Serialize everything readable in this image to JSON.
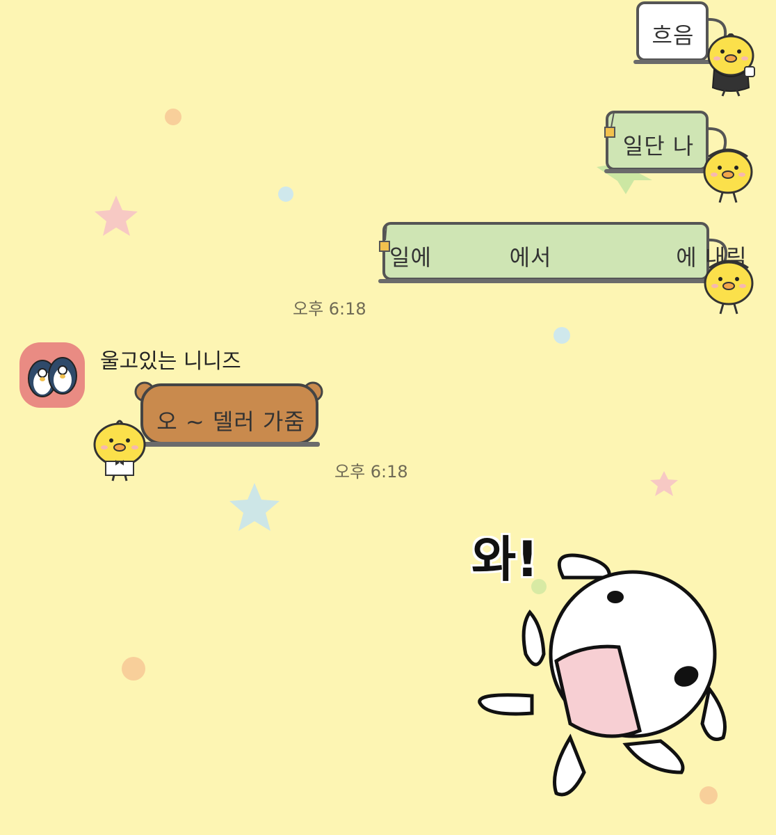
{
  "theme": {
    "background": "#fdf5b3",
    "sent_bubble": "#cfe5b4",
    "sent_plain_bubble": "#ffffff",
    "received_bubble": "#c98a4d"
  },
  "sent": {
    "msg1": {
      "text": "흐음",
      "icon": "butler-chick-icon"
    },
    "msg2": {
      "text": "일단 나",
      "icon": "maid-chick-icon"
    },
    "msg3": {
      "text": "일에          에서                에 내림",
      "icon": "maid-chick-icon"
    },
    "time": "오후 6:18"
  },
  "received": {
    "sender_name": "울고있는 니니즈",
    "avatar": "penguin-pair-avatar",
    "msg1": {
      "text": "오 ~ 델러 가줌",
      "icon": "waiter-chick-icon"
    },
    "time": "오후 6:18"
  },
  "sticker": {
    "text": "와!",
    "icon": "white-puppy-sticker-icon"
  }
}
